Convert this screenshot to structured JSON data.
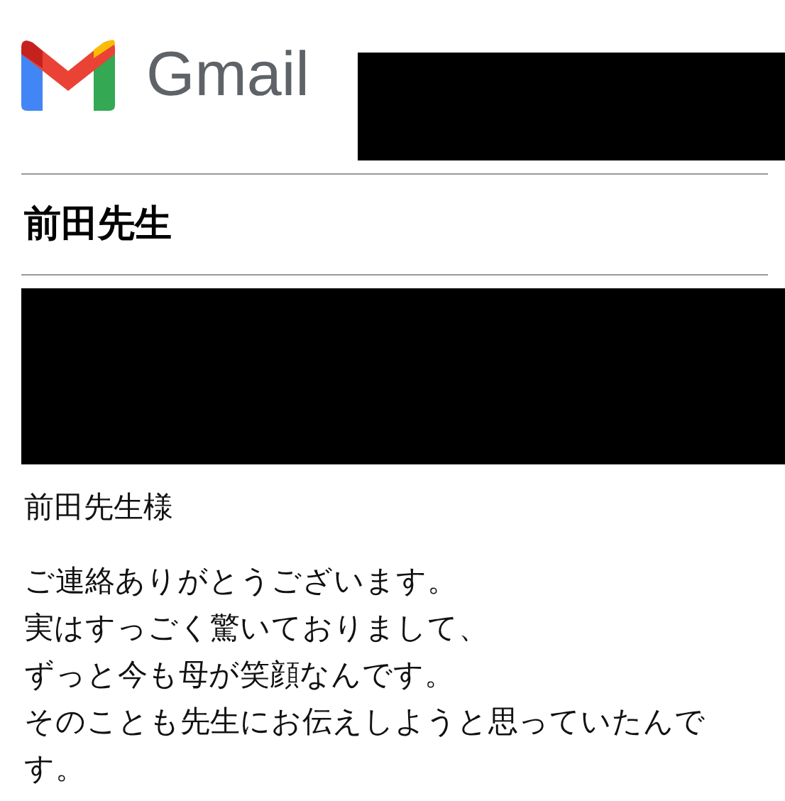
{
  "header": {
    "logo_text": "Gmail"
  },
  "subject": "前田先生",
  "message": {
    "greeting": "前田先生様",
    "lines": [
      "ご連絡ありがとうございます。",
      "実はすっごく驚いておりまして、",
      "ずっと今も母が笑顔なんです。",
      "そのことも先生にお伝えしようと思っていたんです。"
    ]
  }
}
